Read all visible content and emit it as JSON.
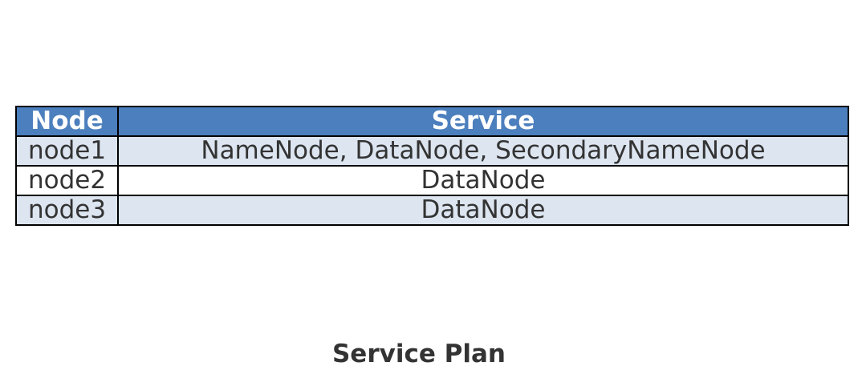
{
  "chart_data": {
    "type": "table",
    "title": "Service Plan",
    "columns": [
      "Node",
      "Service"
    ],
    "rows": [
      [
        "node1",
        "NameNode, DataNode, SecondaryNameNode"
      ],
      [
        "node2",
        "DataNode"
      ],
      [
        "node3",
        "DataNode"
      ]
    ]
  },
  "colors": {
    "header_background": "#4c7fbd",
    "header_text": "#ffffff",
    "striped_row_background": "#dce5f0",
    "plain_row_background": "#ffffff",
    "cell_text": "#333333",
    "border": "#000000"
  }
}
